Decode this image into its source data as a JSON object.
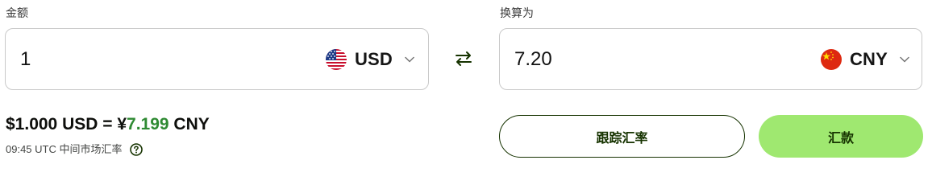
{
  "amount": {
    "label": "金额",
    "value": "1",
    "currency": "USD",
    "flag_icon": "us-flag-icon"
  },
  "converted": {
    "label": "换算为",
    "value": "7.20",
    "currency": "CNY",
    "flag_icon": "cn-flag-icon"
  },
  "swap_icon": "swap-arrows-icon",
  "rate": {
    "prefix": "$1.000 USD = ¥",
    "highlight": "7.199",
    "suffix": " CNY",
    "meta": "09:45 UTC 中间市场汇率"
  },
  "buttons": {
    "track": "跟踪汇率",
    "send": "汇款"
  },
  "colors": {
    "accent": "#9fe870",
    "dark_green": "#163300",
    "rate_green": "#2f8a33"
  }
}
